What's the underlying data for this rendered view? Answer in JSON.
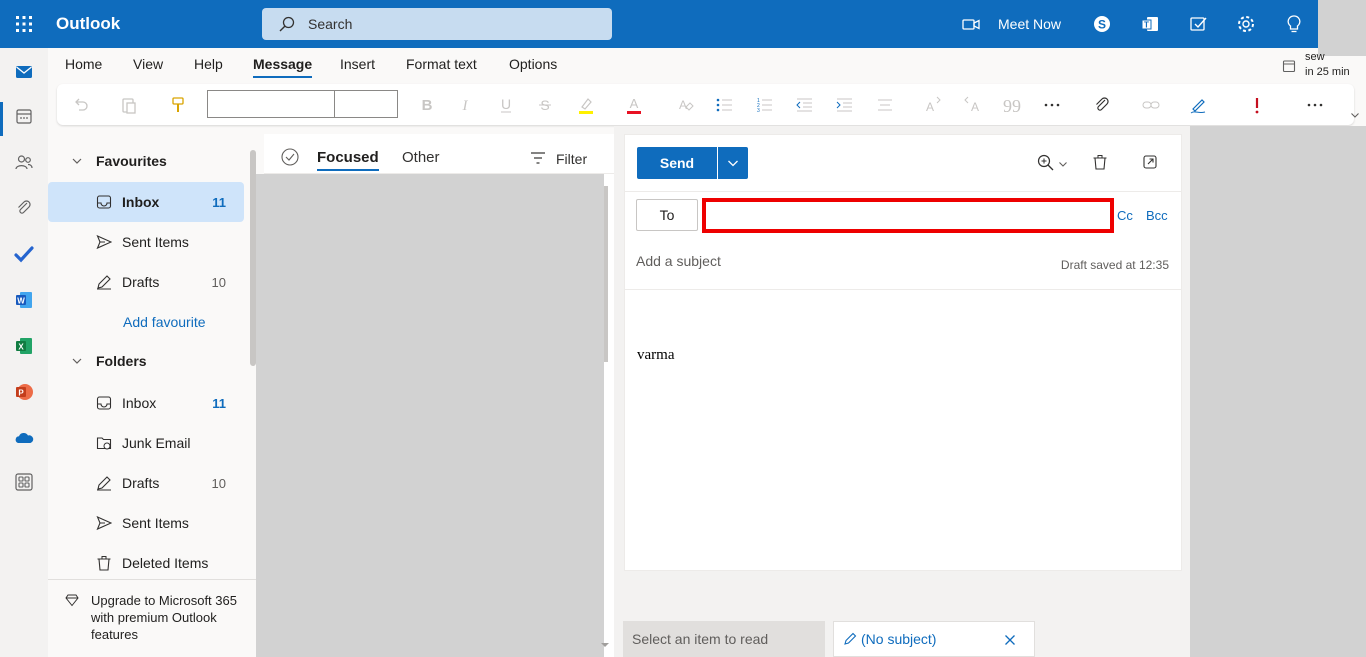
{
  "app": {
    "title": "Outlook"
  },
  "search": {
    "placeholder": "Search"
  },
  "topbar": {
    "meet_now_label": "Meet Now",
    "icons": [
      "waffle-icon",
      "video-icon",
      "skype-icon",
      "teams-icon",
      "todo-icon",
      "gear-icon",
      "lightbulb-icon"
    ]
  },
  "ribbon": {
    "tabs": [
      "Home",
      "View",
      "Help",
      "Message",
      "Insert",
      "Format text",
      "Options"
    ],
    "active_tab": "Message",
    "reminder": {
      "title": "sew",
      "time": "in 25 min"
    }
  },
  "folders": {
    "favourites_label": "Favourites",
    "favourites": [
      {
        "label": "Inbox",
        "count": "11"
      },
      {
        "label": "Sent Items",
        "count": ""
      },
      {
        "label": "Drafts",
        "count": "10"
      }
    ],
    "add_favourite": "Add favourite",
    "folders_label": "Folders",
    "items": [
      {
        "label": "Inbox",
        "count": "11"
      },
      {
        "label": "Junk Email",
        "count": ""
      },
      {
        "label": "Drafts",
        "count": "10"
      },
      {
        "label": "Sent Items",
        "count": ""
      },
      {
        "label": "Deleted Items",
        "count": ""
      }
    ],
    "upgrade": "Upgrade to Microsoft 365 with premium Outlook features"
  },
  "message_list": {
    "tab_focused": "Focused",
    "tab_other": "Other",
    "filter_label": "Filter"
  },
  "compose": {
    "send_label": "Send",
    "to_label": "To",
    "to_value": "",
    "cc_label": "Cc",
    "bcc_label": "Bcc",
    "subject_placeholder": "Add a subject",
    "draft_saved": "Draft saved at 12:35",
    "body": "varma"
  },
  "bottom": {
    "select_item": "Select an item to read",
    "draft_tab": "(No subject)"
  },
  "colors": {
    "brand": "#0f6cbd",
    "highlight_box": "#e00000"
  }
}
